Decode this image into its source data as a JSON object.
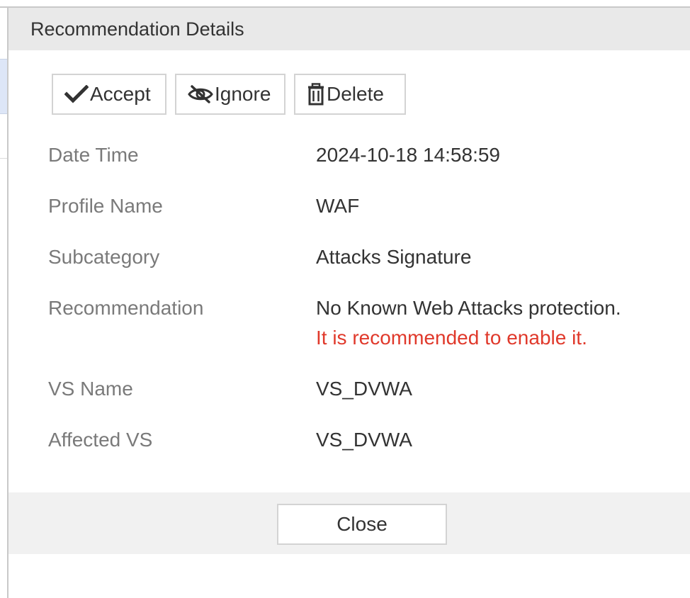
{
  "dialog": {
    "title": "Recommendation Details"
  },
  "toolbar": {
    "accept_label": "Accept",
    "ignore_label": "Ignore",
    "delete_label": "Delete",
    "accept_icon": "checkmark-icon",
    "ignore_icon": "eye-slash-icon",
    "delete_icon": "trash-icon"
  },
  "details": [
    {
      "label": "Date Time",
      "value": "2024-10-18 14:58:59"
    },
    {
      "label": "Profile Name",
      "value": "WAF"
    },
    {
      "label": "Subcategory",
      "value": "Attacks Signature"
    },
    {
      "label": "Recommendation",
      "value": "No Known Web Attacks protection.",
      "note": "It is recommended to enable it."
    },
    {
      "label": "VS Name",
      "value": "VS_DVWA"
    },
    {
      "label": "Affected VS",
      "value": "VS_DVWA"
    }
  ],
  "footer": {
    "close_label": "Close"
  },
  "colors": {
    "warning": "#e0392b",
    "header_bg": "#e9e9e9",
    "label": "#7a7a7a"
  }
}
